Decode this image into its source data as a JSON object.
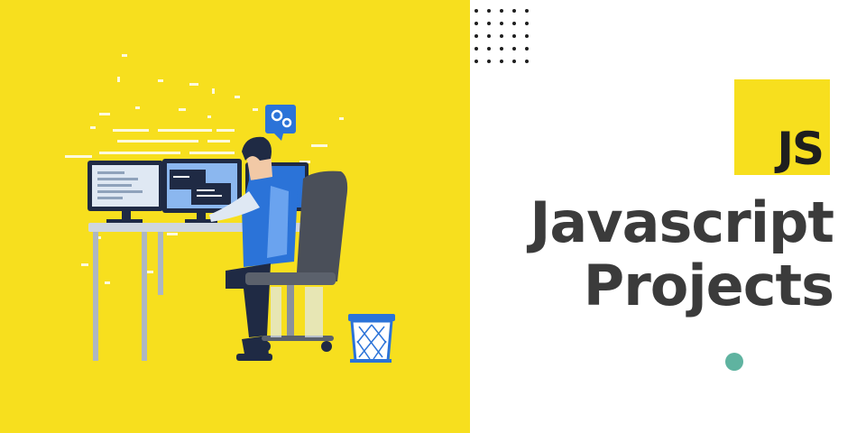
{
  "logo": {
    "text": "JS"
  },
  "title": {
    "line1": "Javascript",
    "line2": "Projects"
  },
  "colors": {
    "accent_yellow": "#f7df1e",
    "title_text": "#3b3b3b",
    "illustration_blue": "#2b73d8",
    "teal_dot": "#5fb3a0"
  },
  "icons": [
    "gear-chat-icon",
    "js-logo",
    "waste-basket",
    "office-chair",
    "computer-monitors"
  ]
}
